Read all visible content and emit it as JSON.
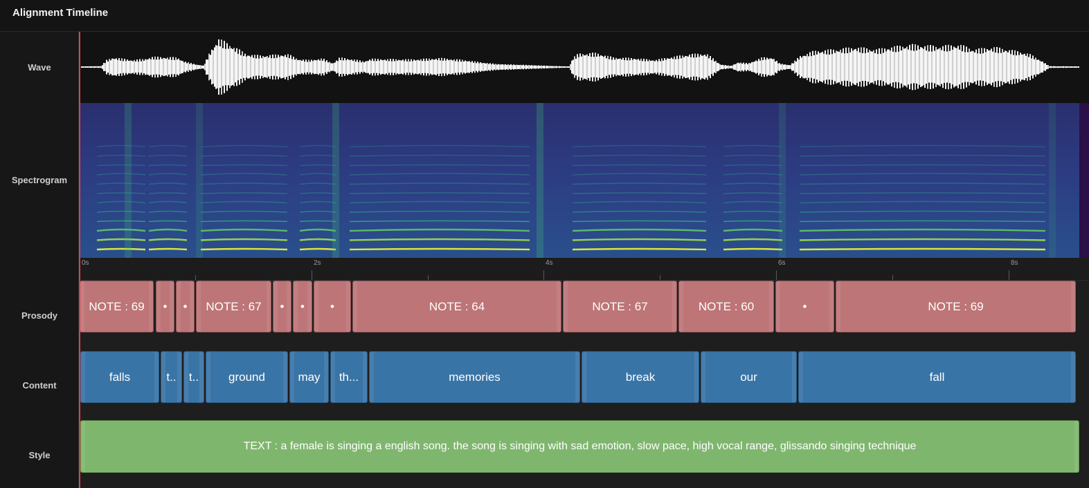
{
  "header": {
    "title": "Alignment Timeline"
  },
  "rows": {
    "wave": "Wave",
    "spectrogram": "Spectrogram",
    "prosody": "Prosody",
    "content": "Content",
    "style": "Style"
  },
  "axis": {
    "ticks": [
      "0s",
      "2s",
      "4s",
      "6s",
      "8s"
    ]
  },
  "prosody": [
    "NOTE : 69",
    "•",
    "•",
    "NOTE : 67",
    "•",
    "•",
    "•",
    "NOTE : 64",
    "NOTE : 67",
    "NOTE : 60",
    "•",
    "NOTE : 69"
  ],
  "content": [
    "falls",
    "t..",
    "t..",
    "ground",
    "may",
    "th...",
    "memories",
    "break",
    "our",
    "fall"
  ],
  "style": {
    "text": "TEXT : a female is singing a english song. the song is singing with sad emotion, slow pace, high vocal range, glissando singing technique"
  },
  "colors": {
    "prosody": "#bd7577",
    "content": "#3974a6",
    "style": "#7fb66e",
    "playhead": "#e2414b"
  }
}
